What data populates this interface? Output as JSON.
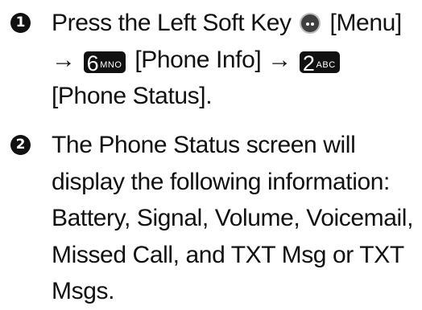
{
  "steps": [
    {
      "number": "1",
      "line1": {
        "text_before": "Press the Left Soft Key",
        "key_icon": "softkey-ellipsis-icon",
        "text_after": "[Menu]"
      },
      "line2": {
        "arrow_a": "→",
        "key_a_digit": "6",
        "key_a_letters": "MNO",
        "label_a": "[Phone Info]",
        "arrow_b": "→",
        "key_b_digit": "2",
        "key_b_letters": "ABC"
      },
      "line3": "[Phone Status]."
    },
    {
      "number": "2",
      "lines": [
        "The Phone Status screen will",
        "display the following information:",
        "Battery, Signal, Volume, Voicemail,",
        "Missed Call, and TXT Msg or TXT",
        "Msgs."
      ]
    }
  ]
}
